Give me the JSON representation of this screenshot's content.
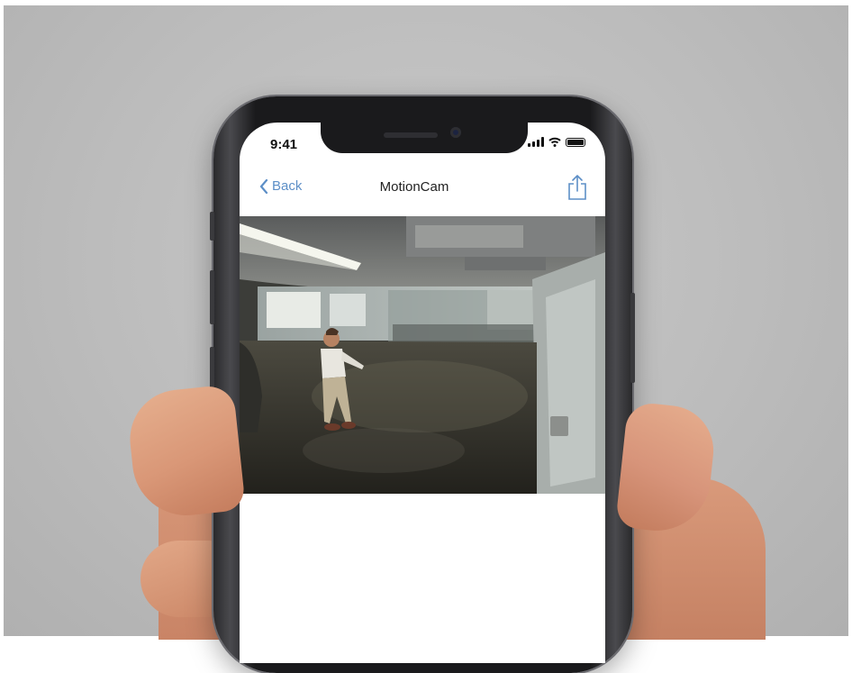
{
  "status_bar": {
    "time": "9:41",
    "icons": [
      "cellular-signal-icon",
      "wifi-icon",
      "battery-icon"
    ]
  },
  "nav_bar": {
    "back_label": "Back",
    "back_icon": "chevron-left-icon",
    "title": "MotionCam",
    "share_icon": "share-icon",
    "accent_color": "#5d8fc7"
  },
  "camera_feed": {
    "content": "live-camera-view",
    "icon": "video-feed"
  }
}
